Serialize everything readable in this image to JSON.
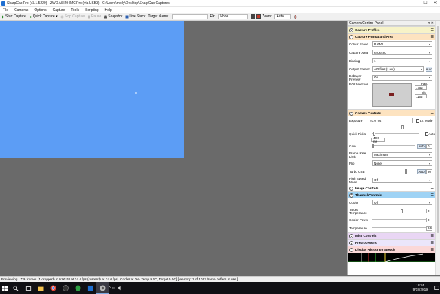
{
  "window": {
    "title": "SharpCap Pro (v3.1.5220) - ZWO ASI294MC Pro (via USB3) - C:\\Users\\molly\\Desktop\\SharpCap Captures"
  },
  "menu": [
    "File",
    "Cameras",
    "Options",
    "Capture",
    "Tools",
    "Scripting",
    "Help"
  ],
  "toolbar": {
    "start_capture": "Start Capture",
    "quick_capture": "Quick Capture",
    "stop_capture": "Stop Capture",
    "pause": "Pause",
    "snapshot": "Snapshot",
    "live_stack": "Live Stack",
    "target_name_label": "Target Name:",
    "target_name_value": "",
    "fx_label": "FX:",
    "fx_value": "None",
    "zoom_label": "Zoom:",
    "zoom_value": "Auto"
  },
  "panel": {
    "title": "Camera Control Panel",
    "capture_profiles": "Capture Profiles",
    "capture_format": {
      "title": "Capture Format and Area",
      "colour_space_label": "Colour Space",
      "colour_space_value": "RAW8",
      "capture_area_label": "Capture Area",
      "capture_area_value": "640x480",
      "binning_label": "Binning",
      "binning_value": "1",
      "output_format_label": "Output Format",
      "output_format_value": "AVI files (*.avi)",
      "auto_label": "Auto",
      "debayer_label": "Debayer Preview",
      "debayer_value": "On",
      "roi_label": "ROI Selection",
      "pan_label": "Pan:",
      "pan_value": "1752",
      "tilt_label": "Tilt:",
      "tilt_value": "1165"
    },
    "camera_controls": {
      "title": "Camera Controls",
      "exposure_label": "Exposure",
      "exposure_value": "40.0 ms",
      "lx_mode_label": "LX Mode",
      "quick_picks_label": "Quick Picks",
      "quick_picks_value": "40.0 ms",
      "auto_label": "Auto",
      "gain_label": "Gain",
      "gain_auto": "Auto",
      "gain_value": "0",
      "frame_rate_label": "Frame Rate Limit",
      "frame_rate_value": "Maximum",
      "flip_label": "Flip",
      "flip_value": "None",
      "turbo_usb_label": "Turbo USB",
      "turbo_auto": "Auto",
      "turbo_value": "80",
      "high_speed_label": "High Speed Mode",
      "high_speed_value": "Off"
    },
    "image_controls": "Image Controls",
    "thermal_controls": {
      "title": "Thermal Controls",
      "cooler_label": "Cooler",
      "cooler_value": "Off",
      "target_temp_label": "Target Temperature",
      "target_temp_value": "0",
      "cooler_power_label": "Cooler Power",
      "cooler_power_value": "0",
      "temperature_label": "Temperature",
      "temperature_value": "9.6"
    },
    "misc_controls": "Misc Controls",
    "preprocessing": "Preprocessing",
    "display_histogram": "Display Histogram Stretch"
  },
  "status": {
    "text": "Previewing : 736 frames (1 dropped) in 0:00:08 at 24.4 fps  (currently at 24.0 fps) [Cooler at 0%, Temp 9.6C, Target 0.0C] [Memory: 1 of 1022 frame buffers in use.]"
  },
  "taskbar": {
    "time": "18:54",
    "date": "9/18/2019"
  },
  "colors": {
    "preview": "#5c9df5",
    "workspace": "#6a6a6a"
  }
}
